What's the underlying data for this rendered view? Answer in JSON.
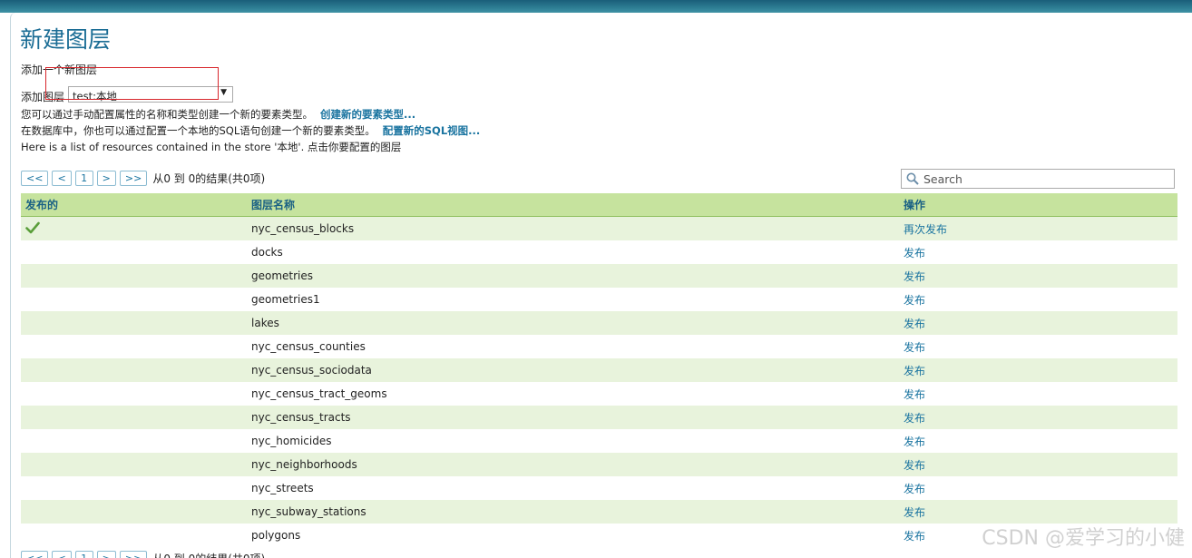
{
  "page": {
    "title": "新建图层",
    "subtitle": "添加一个新图层",
    "add_layer_label": "添加图层",
    "store_select_value": "test:本地"
  },
  "info": {
    "line1_text": "您可以通过手动配置属性的名称和类型创建一个新的要素类型。",
    "line1_link": "创建新的要素类型...",
    "line2_text": "在数据库中，你也可以通过配置一个本地的SQL语句创建一个新的要素类型。",
    "line2_link": "配置新的SQL视图...",
    "line3_text": "Here is a list of resources contained in the store '本地'. 点击你要配置的图层"
  },
  "pager": {
    "first": "<<",
    "prev": "<",
    "page": "1",
    "next": ">",
    "last": ">>",
    "result_text": "从0 到 0的结果(共0项)"
  },
  "search": {
    "placeholder": "Search"
  },
  "table": {
    "headers": [
      "发布的",
      "图层名称",
      "操作"
    ],
    "rows": [
      {
        "published": true,
        "name": "nyc_census_blocks",
        "action": "再次发布"
      },
      {
        "published": false,
        "name": "docks",
        "action": "发布"
      },
      {
        "published": false,
        "name": "geometries",
        "action": "发布"
      },
      {
        "published": false,
        "name": "geometries1",
        "action": "发布"
      },
      {
        "published": false,
        "name": "lakes",
        "action": "发布"
      },
      {
        "published": false,
        "name": "nyc_census_counties",
        "action": "发布"
      },
      {
        "published": false,
        "name": "nyc_census_sociodata",
        "action": "发布"
      },
      {
        "published": false,
        "name": "nyc_census_tract_geoms",
        "action": "发布"
      },
      {
        "published": false,
        "name": "nyc_census_tracts",
        "action": "发布"
      },
      {
        "published": false,
        "name": "nyc_homicides",
        "action": "发布"
      },
      {
        "published": false,
        "name": "nyc_neighborhoods",
        "action": "发布"
      },
      {
        "published": false,
        "name": "nyc_streets",
        "action": "发布"
      },
      {
        "published": false,
        "name": "nyc_subway_stations",
        "action": "发布"
      },
      {
        "published": false,
        "name": "polygons",
        "action": "发布"
      }
    ]
  },
  "watermark": "CSDN @爱学习的小健",
  "colors": {
    "accent": "#1a74a0",
    "title": "#1b6d95",
    "header_bg": "#c6e39e",
    "row_alt": "#e8f3dc",
    "highlight": "#d8252b"
  }
}
